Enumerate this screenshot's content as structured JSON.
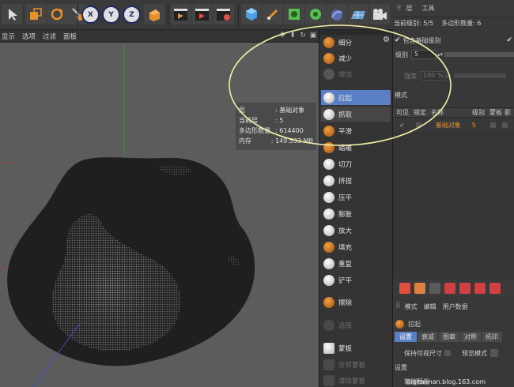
{
  "viewport_menu": {
    "items": [
      "显示",
      "选项",
      "过滤",
      "面板"
    ]
  },
  "viewport_nav_icons": [
    "move-icon",
    "arrow-down-icon",
    "rotate-icon",
    "maximize-icon"
  ],
  "hud": {
    "layer": {
      "key": "层",
      "value": ": 基础对象"
    },
    "current_level": {
      "key": "当前层",
      "value": ": 5"
    },
    "polygon_count": {
      "key": "多边形数量",
      "value": ": 614400"
    },
    "memory": {
      "key": "内存",
      "value": ": 149.533 MB"
    }
  },
  "tools": {
    "subdivide": "细分",
    "decrease": "减少",
    "increase": "增加",
    "pull": "拉起",
    "grab": "抓取",
    "smooth": "平滑",
    "wax": "蜡雕",
    "knife": "切刀",
    "pinch": "挤捏",
    "flatten": "压平",
    "inflate": "膨胀",
    "amplify": "放大",
    "fill": "填充",
    "repeat": "重复",
    "scrape": "铲平",
    "erase": "擦除",
    "select": "选择",
    "mask": "蒙板",
    "sym_mask": "反转蒙板",
    "extra": "清除蒙板"
  },
  "right_panel": {
    "top_tabs": {
      "layer": "层",
      "tools": "工具"
    },
    "current_level": "当前级别: 5/5",
    "polygon_count": "多边形数量: 6",
    "include_base": "包含基础级别",
    "level_label": "级别",
    "level_value": "5",
    "strength_label": "强度",
    "strength_value": "100 %",
    "mode_label": "模式",
    "col_headers": [
      "可见",
      "锁定",
      "名称",
      "级别",
      "蒙板",
      "影"
    ],
    "row": {
      "name": "基础对象",
      "level": "5"
    },
    "attr_menu": [
      "模式",
      "编辑",
      "用户数据"
    ],
    "attr_title": "拉起",
    "attr_tabs": [
      "设置",
      "衰减",
      "图章",
      "对称",
      "拓印"
    ],
    "keep_visible": "保持可视尺寸",
    "preview_mode": "预览模式",
    "settings_label": "设置",
    "brush_preset": "笔刷预设"
  },
  "watermark": "digitalman.blog.163.com",
  "colors": {
    "accent_blue": "#5b7fc4",
    "orange": "#e8902a",
    "highlight_ellipse": "#f2efa6",
    "mesh_dark": "#1f1f1f",
    "viewport_bg": "#5c5c5c"
  }
}
